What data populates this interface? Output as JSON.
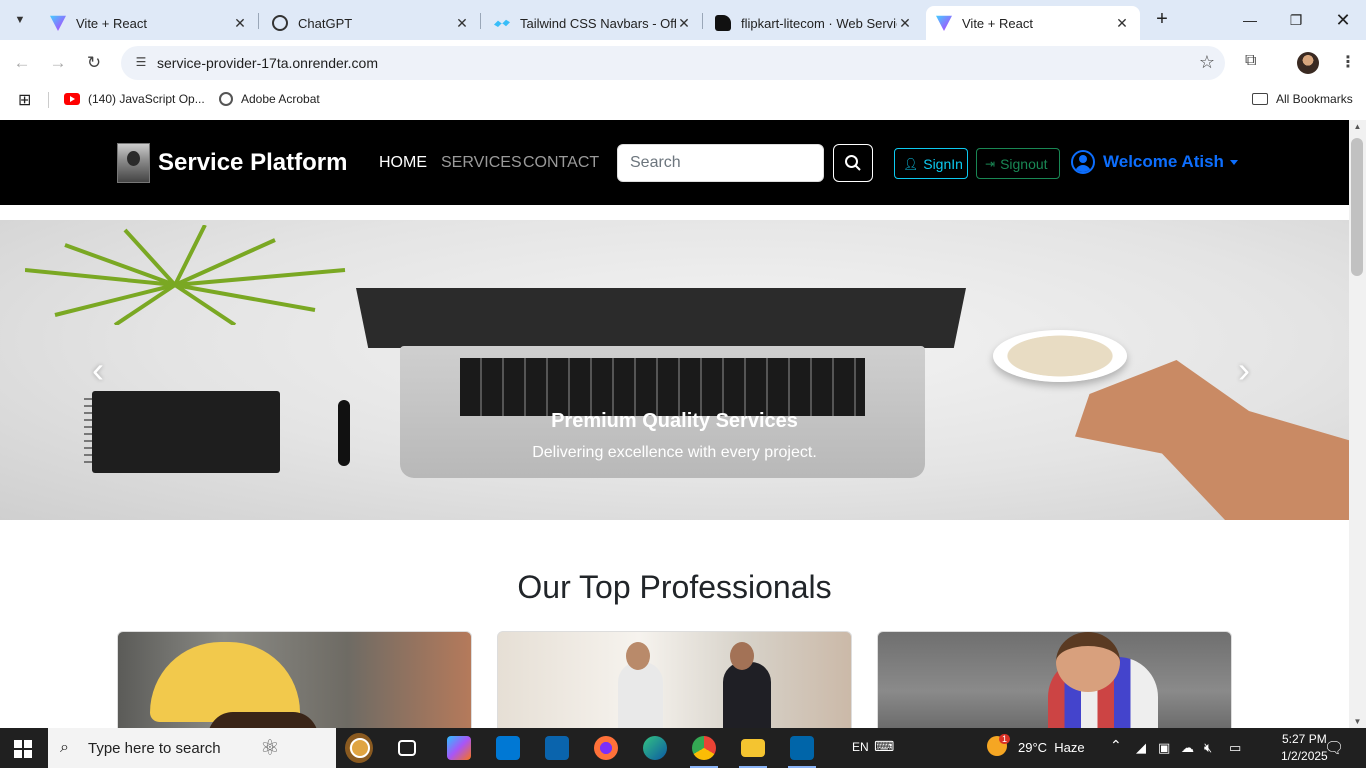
{
  "browser": {
    "tabs": [
      {
        "title": "Vite + React",
        "icon": "vite-icon"
      },
      {
        "title": "ChatGPT",
        "icon": "chatgpt-icon"
      },
      {
        "title": "Tailwind CSS Navbars - Offic",
        "icon": "tailwind-icon"
      },
      {
        "title": "flipkart-litecom · Web Servic",
        "icon": "render-icon"
      },
      {
        "title": "Vite + React",
        "icon": "vite-icon",
        "active": true
      }
    ],
    "url": "service-provider-17ta.onrender.com",
    "bookmarks": [
      {
        "label": "(140) JavaScript Op...",
        "icon": "youtube-icon"
      },
      {
        "label": "Adobe Acrobat",
        "icon": "globe-icon"
      }
    ],
    "all_bookmarks": "All Bookmarks"
  },
  "site": {
    "brand": "Service Platform",
    "nav": [
      "HOME",
      "SERVICES",
      "CONTACT"
    ],
    "search_placeholder": "Search",
    "signin_label": "SignIn",
    "signout_label": "Signout",
    "welcome": "Welcome Atish"
  },
  "hero": {
    "title": "Premium Quality Services",
    "subtitle": "Delivering excellence with every project.",
    "prev_glyph": "‹",
    "next_glyph": "›"
  },
  "section": {
    "title": "Our Top Professionals"
  },
  "taskbar": {
    "search_text": "Type here to search",
    "language": "EN",
    "weather": "29°C  Haze",
    "weather_badge": "1",
    "time": "5:27 PM",
    "date": "1/2/2025"
  },
  "colors": {
    "navbar_bg": "#000000",
    "signin": "#0dcaf0",
    "signout": "#198754",
    "welcome": "#0d6efd",
    "chrome_tabstrip": "#dfe9f7"
  }
}
